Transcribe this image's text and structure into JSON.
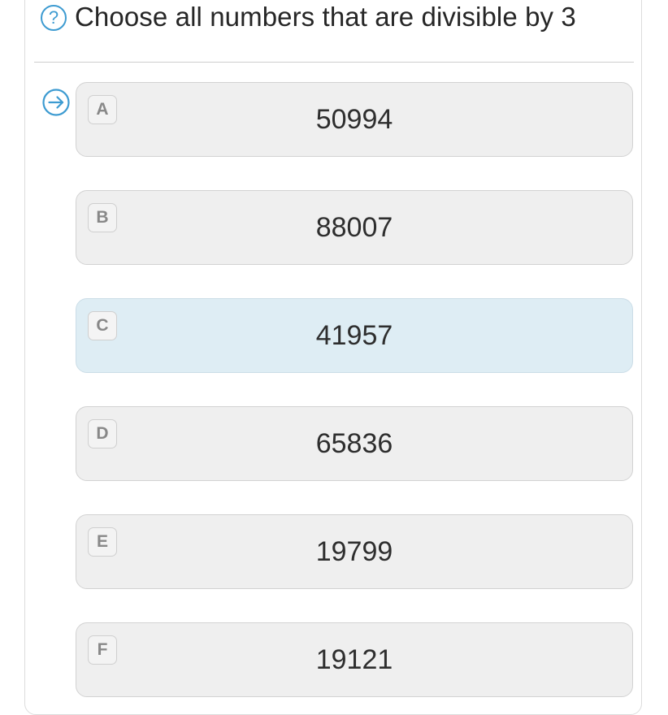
{
  "question": {
    "icon": "question-circle-icon",
    "icon_glyph": "?",
    "text": "Choose all numbers that are divisible by 3"
  },
  "pointer_icon": "arrow-right-circle-icon",
  "colors": {
    "accent": "#3d9bd1",
    "option_bg": "#efefef",
    "option_selected_bg": "#deedf4"
  },
  "options": [
    {
      "letter": "A",
      "value": "50994",
      "selected": false
    },
    {
      "letter": "B",
      "value": "88007",
      "selected": false
    },
    {
      "letter": "C",
      "value": "41957",
      "selected": true
    },
    {
      "letter": "D",
      "value": "65836",
      "selected": false
    },
    {
      "letter": "E",
      "value": "19799",
      "selected": false
    },
    {
      "letter": "F",
      "value": "19121",
      "selected": false
    }
  ]
}
